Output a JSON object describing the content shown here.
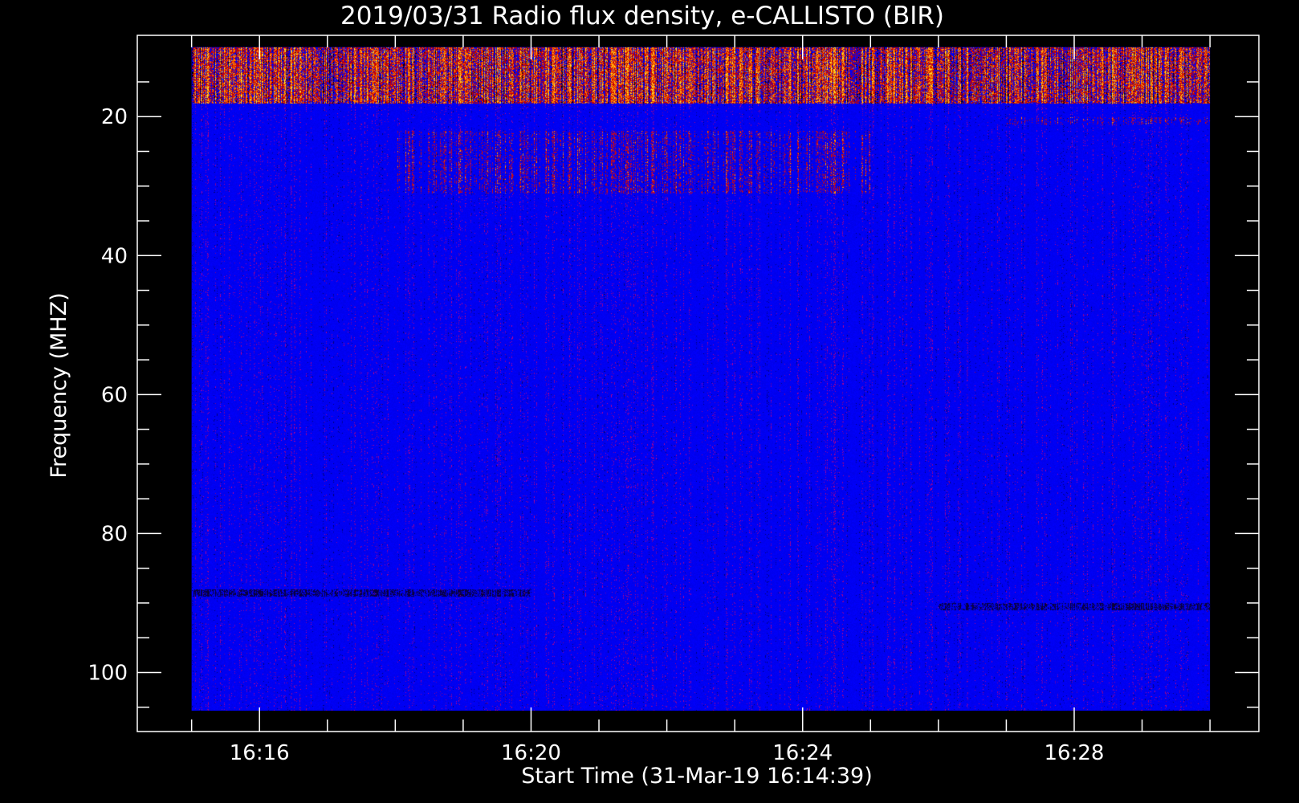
{
  "chart_data": {
    "type": "heatmap",
    "title": "2019/03/31  Radio flux density, e-CALLISTO (BIR)",
    "xlabel": "Start Time (31-Mar-19 16:14:39)",
    "ylabel": "Frequency (MHZ)",
    "x_ticks": [
      "16:16",
      "16:20",
      "16:24",
      "16:28"
    ],
    "x_tick_values_min": [
      16,
      20,
      24,
      28
    ],
    "y_ticks": [
      "20",
      "40",
      "60",
      "80",
      "100"
    ],
    "y_tick_values": [
      20,
      40,
      60,
      80,
      100
    ],
    "xlim_min": [
      14.2,
      30.72
    ],
    "ylim": [
      108.5,
      8.3
    ],
    "data_extent": {
      "time_min": [
        15,
        30
      ],
      "freq_mhz": [
        10,
        105.5
      ]
    },
    "colormap": [
      "#000000",
      "#0000ff",
      "#c80000",
      "#ff7800",
      "#ffe600",
      "#ffffff"
    ],
    "background_color": "#0000ff",
    "features": [
      {
        "freq_mhz": [
          10,
          18
        ],
        "time_min": [
          15,
          30
        ],
        "intensity": "high",
        "label": ""
      },
      {
        "freq_mhz": [
          20,
          21
        ],
        "time_min": [
          27,
          30
        ],
        "intensity": "moderate",
        "label": ""
      },
      {
        "freq_mhz": [
          22,
          31
        ],
        "time_min": [
          18,
          25
        ],
        "intensity": "moderate",
        "label": ""
      },
      {
        "freq_mhz": [
          88,
          89
        ],
        "time_min": [
          15,
          20
        ],
        "intensity": "low",
        "label": ""
      },
      {
        "freq_mhz": [
          90,
          91
        ],
        "time_min": [
          26,
          30
        ],
        "intensity": "low",
        "label": ""
      }
    ]
  }
}
